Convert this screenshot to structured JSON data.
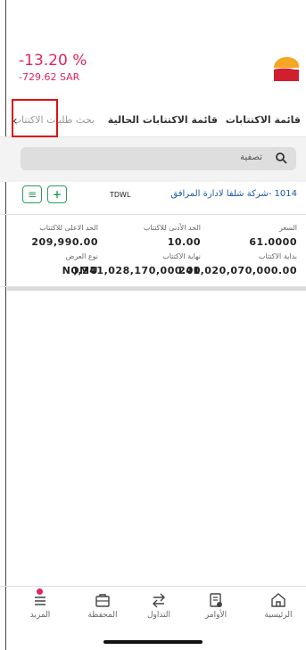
{
  "header": {
    "change_percent": "-13.20 %",
    "change_amount": "-729.62 SAR",
    "logo_icon": "brand-logo",
    "colors": {
      "negative": "#e0245e",
      "logo_top": "#f5a623",
      "logo_bottom": "#d11f2f"
    }
  },
  "tabs": [
    {
      "label": "قائمة الاكتتابات"
    },
    {
      "label": "قائمة الاكتتابات الحالية"
    },
    {
      "label": "بحث طلبات الاكتتاب"
    }
  ],
  "search": {
    "label": "تصفية",
    "icon": "search-icon"
  },
  "ipo": {
    "symbol": "TDWL",
    "company": "1014 -شركة شلفا لادارة المرافق",
    "price_label": "السعر",
    "price_value": "61.0000",
    "min_label": "الحد الأدنى للاكتتاب",
    "min_value": "10.00",
    "max_label": "الحد الاعلى للاكتتاب",
    "max_value": "209,990.00",
    "start_label": "بداية الاكتتاب",
    "start_value": "241,020,070,000.00",
    "end_label": "نهاية الاكتتاب",
    "end_value": "),241,028,170,000.00",
    "offer_label": "نوع العرض",
    "offer_value": "NOMU",
    "accent": "#2a9d5c"
  },
  "nav": [
    {
      "label": "الرئيسية",
      "icon": "home-icon"
    },
    {
      "label": "الأوامر",
      "icon": "orders-icon"
    },
    {
      "label": "التداول",
      "icon": "trade-icon"
    },
    {
      "label": "المحفظة",
      "icon": "portfolio-icon"
    },
    {
      "label": "المزيد",
      "icon": "more-icon"
    }
  ]
}
